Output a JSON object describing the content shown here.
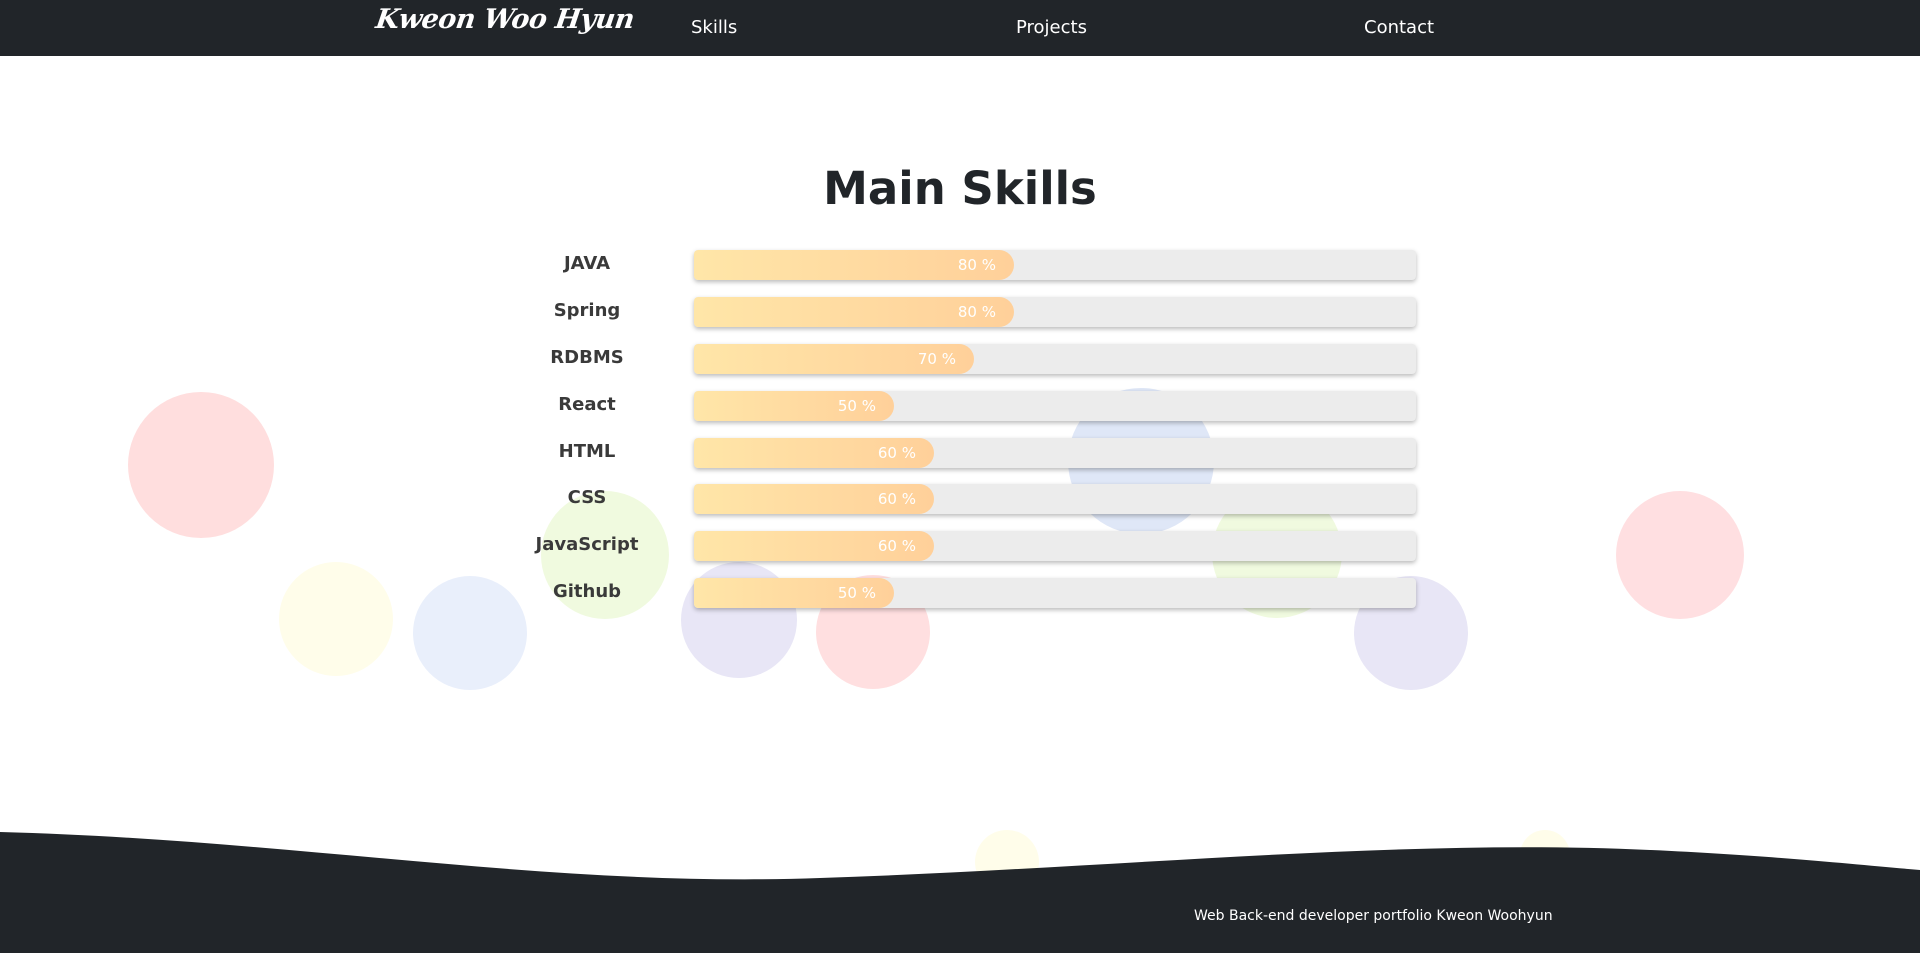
{
  "header": {
    "brand": "Kweon Woo Hyun",
    "nav": [
      "Skills",
      "Projects",
      "Contact"
    ]
  },
  "skills": {
    "title": "Main Skills",
    "items": [
      {
        "name": "JAVA",
        "percent": 80,
        "percent_label": "80 %"
      },
      {
        "name": "Spring",
        "percent": 80,
        "percent_label": "80 %"
      },
      {
        "name": "RDBMS",
        "percent": 70,
        "percent_label": "70 %"
      },
      {
        "name": "React",
        "percent": 50,
        "percent_label": "50 %"
      },
      {
        "name": "HTML",
        "percent": 60,
        "percent_label": "60 %"
      },
      {
        "name": "CSS",
        "percent": 60,
        "percent_label": "60 %"
      },
      {
        "name": "JavaScript",
        "percent": 60,
        "percent_label": "60 %"
      },
      {
        "name": "Github",
        "percent": 50,
        "percent_label": "50 %"
      }
    ]
  },
  "footer": {
    "text": "Web Back-end developer portfolio Kweon Woohyun"
  },
  "colors": {
    "header_bg": "#212529",
    "footer_bg": "#212529",
    "bar_track": "#ececec",
    "bar_fill_start": "#ffe6a8",
    "bar_fill_end": "#ffd09a"
  }
}
